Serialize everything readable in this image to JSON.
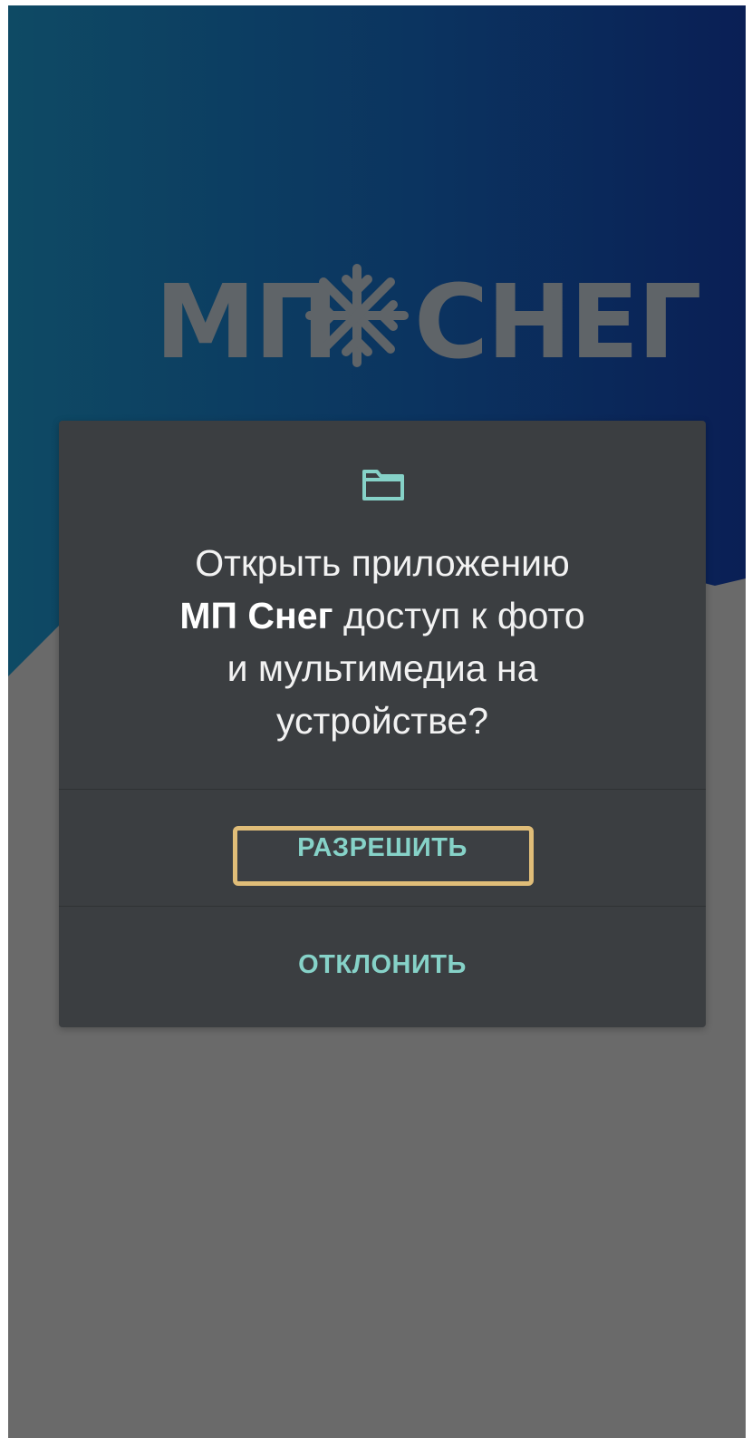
{
  "app": {
    "logo_text_left": "МП",
    "logo_text_right": "СНЕГ",
    "logo_icon": "snowflake-icon"
  },
  "dialog": {
    "icon": "folder-icon",
    "message_app_name": "МП Снег",
    "message_line1": "Открыть приложению",
    "message_after_name": " доступ к фото",
    "message_line3": "и мультимедиа на",
    "message_line4": "устройстве?",
    "allow_label": "РАЗРЕШИТЬ",
    "deny_label": "ОТКЛОНИТЬ"
  },
  "colors": {
    "accent": "#86d2c8",
    "dialog_bg": "#3b3e41",
    "highlight": "#e0bd78",
    "logo": "#5f6468",
    "background_top": "#0b3460",
    "mountain": "#6a6a6a"
  }
}
